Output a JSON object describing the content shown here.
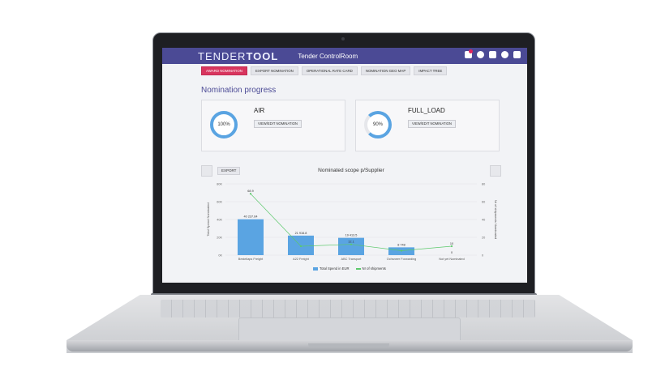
{
  "app": {
    "logo_light": "TENDER",
    "logo_bold": "TOOL",
    "title": "Tender ControlRoom",
    "icons": [
      "notifications-icon",
      "user-icon",
      "card-icon",
      "help-icon",
      "logout-icon"
    ]
  },
  "tabs": [
    {
      "label": "AWARD NOMINATION",
      "active": true
    },
    {
      "label": "EXPORT NOMINATION",
      "active": false
    },
    {
      "label": "OPERATIONAL RATE CARD",
      "active": false
    },
    {
      "label": "NOMINATION GEO MAP",
      "active": false
    },
    {
      "label": "IMPACT TREE",
      "active": false
    }
  ],
  "section_title": "Nomination progress",
  "cards": [
    {
      "name": "AIR",
      "progress": "100%",
      "button": "VIEW/EDIT NOMINATION"
    },
    {
      "name": "FULL_LOAD",
      "progress": "90%",
      "button": "VIEW/EDIT NOMINATION"
    }
  ],
  "chart_toolbar": {
    "export": "EXPORT"
  },
  "colors": {
    "header": "#4b4a95",
    "accent": "#d8355e",
    "bar": "#5aa4e2",
    "line": "#5cc96b"
  },
  "chart_data": {
    "type": "bar",
    "title": "Nominated scope p/Supplier",
    "categories": [
      "Bestellaps Freight",
      "A22 Freight",
      "ABC Transport",
      "Ochsneer Forwarding",
      "Not yet Nominated"
    ],
    "series": [
      {
        "name": "Total Spend in EUR",
        "values": [
          40237.64,
          21916.8,
          19413.5,
          8748,
          0
        ],
        "labels": [
          "40 237.64",
          "21 916.8",
          "19 413.5",
          "8 748",
          "0"
        ]
      },
      {
        "name": "Nr of shipments",
        "values": [
          68.9,
          10,
          12.1,
          5,
          10
        ],
        "labels": [
          "68.9",
          "",
          "12.1",
          "",
          "10"
        ]
      }
    ],
    "ylabel": "Total Spend Nominated",
    "y2label": "Nr of shipments Nominated",
    "yticks": [
      "80K",
      "60K",
      "40K",
      "20K",
      "0K"
    ],
    "y2ticks": [
      "80",
      "60",
      "40",
      "20",
      "0"
    ],
    "ylim": [
      0,
      80000
    ],
    "y2lim": [
      0,
      80
    ]
  }
}
